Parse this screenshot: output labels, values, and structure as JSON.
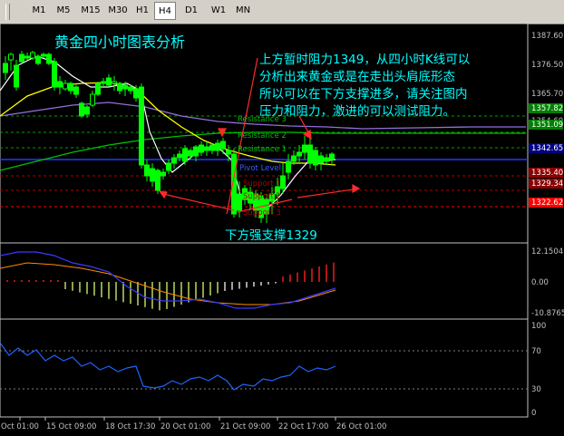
{
  "toolbar": {
    "timeframes": [
      "M1",
      "M5",
      "M15",
      "M30",
      "H1",
      "H4",
      "D1",
      "W1",
      "MN"
    ],
    "active": "H4"
  },
  "annotations": {
    "title": "黄金四小时图表分析",
    "note_lines": [
      "上方暂时阻力1349，从四小时K线可以",
      "分析出来黄金或是在走出头肩底形态",
      "所以可以在下方支撑进多，请关注图内",
      "压力和阻力，激进的可以测试阻力。"
    ],
    "support_note": "下方强支撑1329"
  },
  "levels": {
    "resistance_labels": [
      "Resistance 3",
      "Resistance 2",
      "Resistance 1"
    ],
    "pivot_label": "Pivot Level",
    "support_labels": [
      "Support 1",
      "Support 2",
      "Support 3"
    ]
  },
  "price_axis": {
    "ticks": [
      "1387.60",
      "1376.50",
      "1365.70",
      "1354.60"
    ],
    "tags": [
      "1357.82",
      "1351.09",
      "1342.65",
      "1335.40",
      "1329.34",
      "1322.62"
    ],
    "tag_colors": [
      "#008000",
      "#008000",
      "#000080",
      "#8b0000",
      "#8b0000",
      "#ff0000"
    ]
  },
  "macd_axis": {
    "ticks": [
      "12.1504",
      "0.00",
      "-10.8765"
    ]
  },
  "osc_axis": {
    "ticks": [
      "100",
      "70",
      "30",
      "0"
    ]
  },
  "time_axis": {
    "labels": [
      "Oct 01:00",
      "15 Oct 09:00",
      "18 Oct 17:30",
      "20 Oct 01:00",
      "21 Oct 09:00",
      "22 Oct 17:00",
      "26 Oct 01:00"
    ]
  },
  "colors": {
    "text_annotation": "#00ffff",
    "arrow": "#ff2a2a",
    "candle": "#00ff00",
    "ma_fast": "#ffffff",
    "ma_mid": "#ffff00",
    "ma_slow": "#9370db",
    "ma_long": "#00c000"
  }
}
